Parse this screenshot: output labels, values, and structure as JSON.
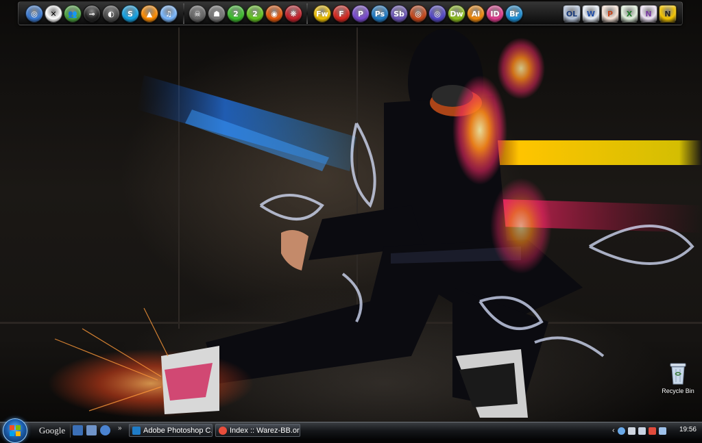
{
  "dock": {
    "group1": [
      {
        "name": "safari-icon",
        "bg": "#3a7bd5",
        "glyph": "◎"
      },
      {
        "name": "xfire-icon",
        "bg": "#ffffff",
        "glyph": "✕",
        "fg": "#000"
      },
      {
        "name": "messenger-icon",
        "bg": "#4aa53d",
        "glyph": "👥"
      },
      {
        "name": "steam-icon",
        "bg": "#222222",
        "glyph": "⊸"
      },
      {
        "name": "winamp-icon",
        "bg": "#4a4a4a",
        "glyph": "◐"
      },
      {
        "name": "skype-icon",
        "bg": "#11a3e6",
        "glyph": "S"
      },
      {
        "name": "vlc-icon",
        "bg": "#ff8c00",
        "glyph": "▲"
      },
      {
        "name": "itunes-icon",
        "bg": "#7ab8ff",
        "glyph": "♫"
      }
    ],
    "group2": [
      {
        "name": "game-shortcut-icon",
        "bg": "#666666",
        "glyph": "☠"
      },
      {
        "name": "crysis-icon",
        "bg": "#777777",
        "glyph": "☗"
      },
      {
        "name": "game-2-icon",
        "bg": "#3cbf2c",
        "glyph": "2"
      },
      {
        "name": "game-2-alt-icon",
        "bg": "#63c720",
        "glyph": "2"
      },
      {
        "name": "origin-icon",
        "bg": "#e6580a",
        "glyph": "◉"
      },
      {
        "name": "bug-app-icon",
        "bg": "#c8202a",
        "glyph": "❋"
      }
    ],
    "group3": [
      {
        "name": "fireworks-icon",
        "bg": "#f2c200",
        "glyph": "Fw"
      },
      {
        "name": "flash-icon",
        "bg": "#d9251d",
        "glyph": "F"
      },
      {
        "name": "premiere-icon",
        "bg": "#7a4ad2",
        "glyph": "P"
      },
      {
        "name": "photoshop-icon",
        "bg": "#1f7cc7",
        "glyph": "Ps"
      },
      {
        "name": "soundbooth-icon",
        "bg": "#6c55b8",
        "glyph": "Sb"
      },
      {
        "name": "flash-catalyst-icon",
        "bg": "#c8471a",
        "glyph": "◎"
      },
      {
        "name": "contribute-icon",
        "bg": "#5448c8",
        "glyph": "◎"
      },
      {
        "name": "dreamweaver-icon",
        "bg": "#8ec11c",
        "glyph": "Dw"
      },
      {
        "name": "illustrator-icon",
        "bg": "#f28a0c",
        "glyph": "Ai"
      },
      {
        "name": "indesign-icon",
        "bg": "#e03a8c",
        "glyph": "ID"
      },
      {
        "name": "bridge-icon",
        "bg": "#1c8fd6",
        "glyph": "Br"
      }
    ],
    "group4": [
      {
        "name": "outlook-icon",
        "bg": "#b9c7dc",
        "glyph": "OL",
        "fg": "#1a3b7a"
      },
      {
        "name": "word-icon",
        "bg": "#e7eef8",
        "glyph": "W",
        "fg": "#1f4ea8"
      },
      {
        "name": "powerpoint-icon",
        "bg": "#f8e4d8",
        "glyph": "P",
        "fg": "#c6441b"
      },
      {
        "name": "excel-icon",
        "bg": "#e2f2de",
        "glyph": "X",
        "fg": "#207b2a"
      },
      {
        "name": "onenote-icon",
        "bg": "#efe4f6",
        "glyph": "N",
        "fg": "#7a3aa2"
      },
      {
        "name": "norton-icon",
        "bg": "#f4c400",
        "glyph": "N",
        "fg": "#222"
      }
    ]
  },
  "desktop": {
    "recycle_bin_label": "Recycle Bin"
  },
  "taskbar": {
    "google_label": "Google",
    "chevron": "»",
    "buttons": [
      {
        "label": "Adobe Photoshop C...",
        "icon_color": "#1f7cc7"
      },
      {
        "label": "Index :: Warez-BB.or...",
        "icon_color": "#e94e3c"
      }
    ],
    "tray_chevron": "‹",
    "tray_icons": [
      {
        "name": "network-icon",
        "color": "#6aa9e8"
      },
      {
        "name": "shield-icon",
        "color": "#cfd6e0"
      },
      {
        "name": "monitor-icon",
        "color": "#c9d3e2"
      },
      {
        "name": "antivirus-icon",
        "color": "#e04b3c"
      },
      {
        "name": "volume-icon",
        "color": "#9ec1ea"
      }
    ],
    "clock": "19:56"
  }
}
